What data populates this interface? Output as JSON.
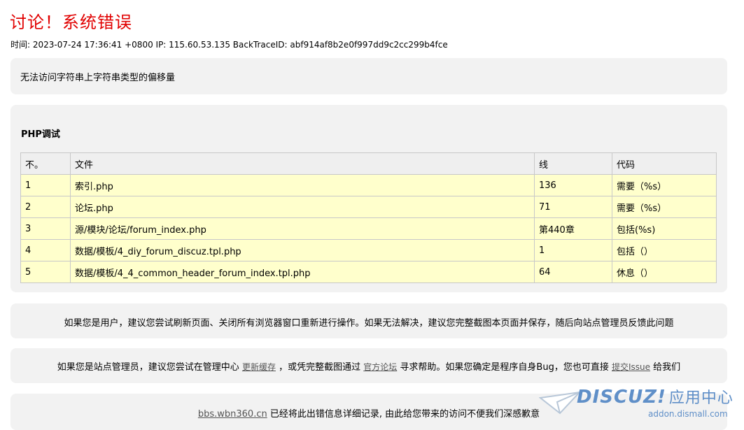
{
  "header": {
    "title": "讨论！系统错误",
    "meta": "时间: 2023-07-24 17:36:41 +0800 IP: 115.60.53.135 BackTraceID: abf914af8b2e0f997dd9c2cc299b4fce"
  },
  "error_message": "无法访问字符串上字符串类型的偏移量",
  "debug": {
    "title": "PHP调试",
    "columns": [
      "不。",
      "文件",
      "线",
      "代码"
    ],
    "rows": [
      [
        "1",
        "索引.php",
        "136",
        "需要（%s）"
      ],
      [
        "2",
        "论坛.php",
        "71",
        "需要（%s）"
      ],
      [
        "3",
        "源/模块/论坛/forum_index.php",
        "第440章",
        "包括(%s)"
      ],
      [
        "4",
        "数据/模板/4_diy_forum_discuz.tpl.php",
        "1",
        "包括（）"
      ],
      [
        "5",
        "数据/模板/4_4_common_header_forum_index.tpl.php",
        "64",
        "休息（）"
      ]
    ]
  },
  "user_tip": "如果您是用户，建议您尝试刷新页面、关闭所有浏览器窗口重新进行操作。如果无法解决，建议您完整截图本页面并保存，随后向站点管理员反馈此问题",
  "admin_tip": {
    "part1": "如果您是站点管理员，建议您尝试在管理中心",
    "link_cache": "更新缓存",
    "part2": "，或凭完整截图通过",
    "link_forum": "官方论坛",
    "part3": "寻求帮助。如果您确定是程序自身Bug，您也可直接",
    "link_issue": "提交Issue",
    "part4": "给我们"
  },
  "footer": {
    "site_link": "bbs.wbn360.cn",
    "text": "已经将此出错信息详细记录, 由此给您带来的访问不便我们深感歉意"
  },
  "watermark": {
    "brand": "DISCUZ!",
    "sub": "应用中心",
    "domain": "addon.dismall.com"
  }
}
